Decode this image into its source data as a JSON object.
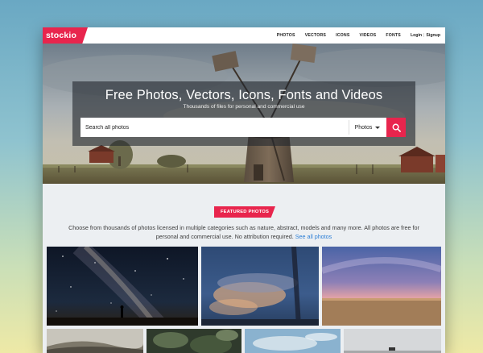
{
  "brand": {
    "logo": "stockio",
    "accent_color": "#e8254d",
    "link_color": "#2d7fd6"
  },
  "nav": {
    "links": [
      "PHOTOS",
      "VECTORS",
      "ICONS",
      "VIDEOS",
      "FONTS"
    ],
    "login": "Login",
    "separator": "|",
    "signup": "Signup"
  },
  "hero": {
    "title": "Free Photos, Vectors, Icons, Fonts and Videos",
    "subtitle": "Thousands of files for personal and commercial use",
    "search_placeholder": "Search all photos",
    "type_selected": "Photos",
    "search_icon": "search-icon"
  },
  "featured": {
    "badge": "FEATURED PHOTOS",
    "description": "Choose from thousands of photos licensed in multiple categories such as nature, abstract, models and many more. All photos are free for personal and commercial use. No attribution required.",
    "link_text": "See all photos"
  }
}
